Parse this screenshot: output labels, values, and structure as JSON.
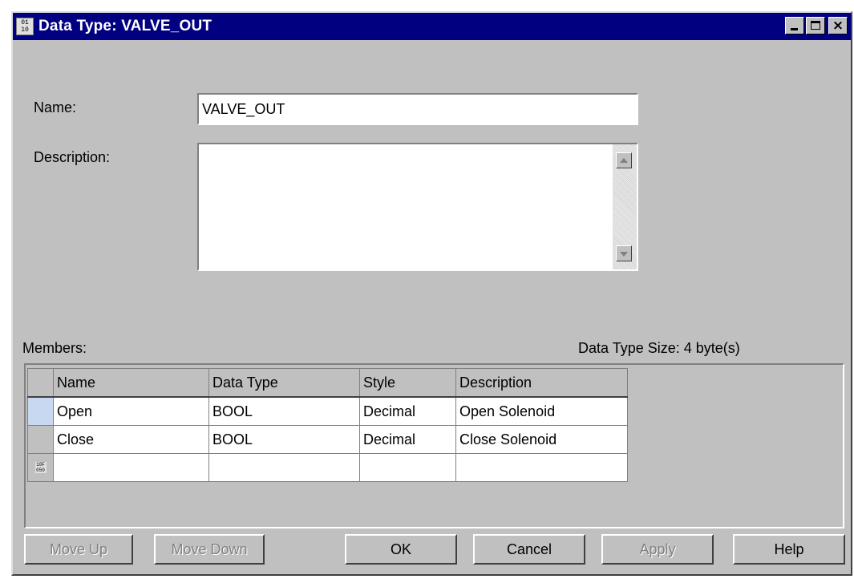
{
  "window": {
    "title": "Data Type:  VALVE_OUT",
    "icon": "data-type-icon"
  },
  "form": {
    "name_label": "Name:",
    "name_value": "VALVE_OUT",
    "description_label": "Description:",
    "description_value": ""
  },
  "members": {
    "label": "Members:",
    "size_text": "Data Type Size: 4 byte(s)",
    "columns": [
      "Name",
      "Data Type",
      "Style",
      "Description"
    ],
    "rows": [
      {
        "name": "Open",
        "data_type": "BOOL",
        "style": "Decimal",
        "description": "Open Solenoid"
      },
      {
        "name": "Close",
        "data_type": "BOOL",
        "style": "Decimal",
        "description": "Close Solenoid"
      },
      {
        "name": "",
        "data_type": "",
        "style": "",
        "description": ""
      }
    ]
  },
  "buttons": {
    "move_up": "Move Up",
    "move_down": "Move Down",
    "ok": "OK",
    "cancel": "Cancel",
    "apply": "Apply",
    "help": "Help"
  },
  "colors": {
    "title_bar": "#000080",
    "dialog_face": "#c0c0c0",
    "selected_row_header": "#c8d8f0"
  }
}
